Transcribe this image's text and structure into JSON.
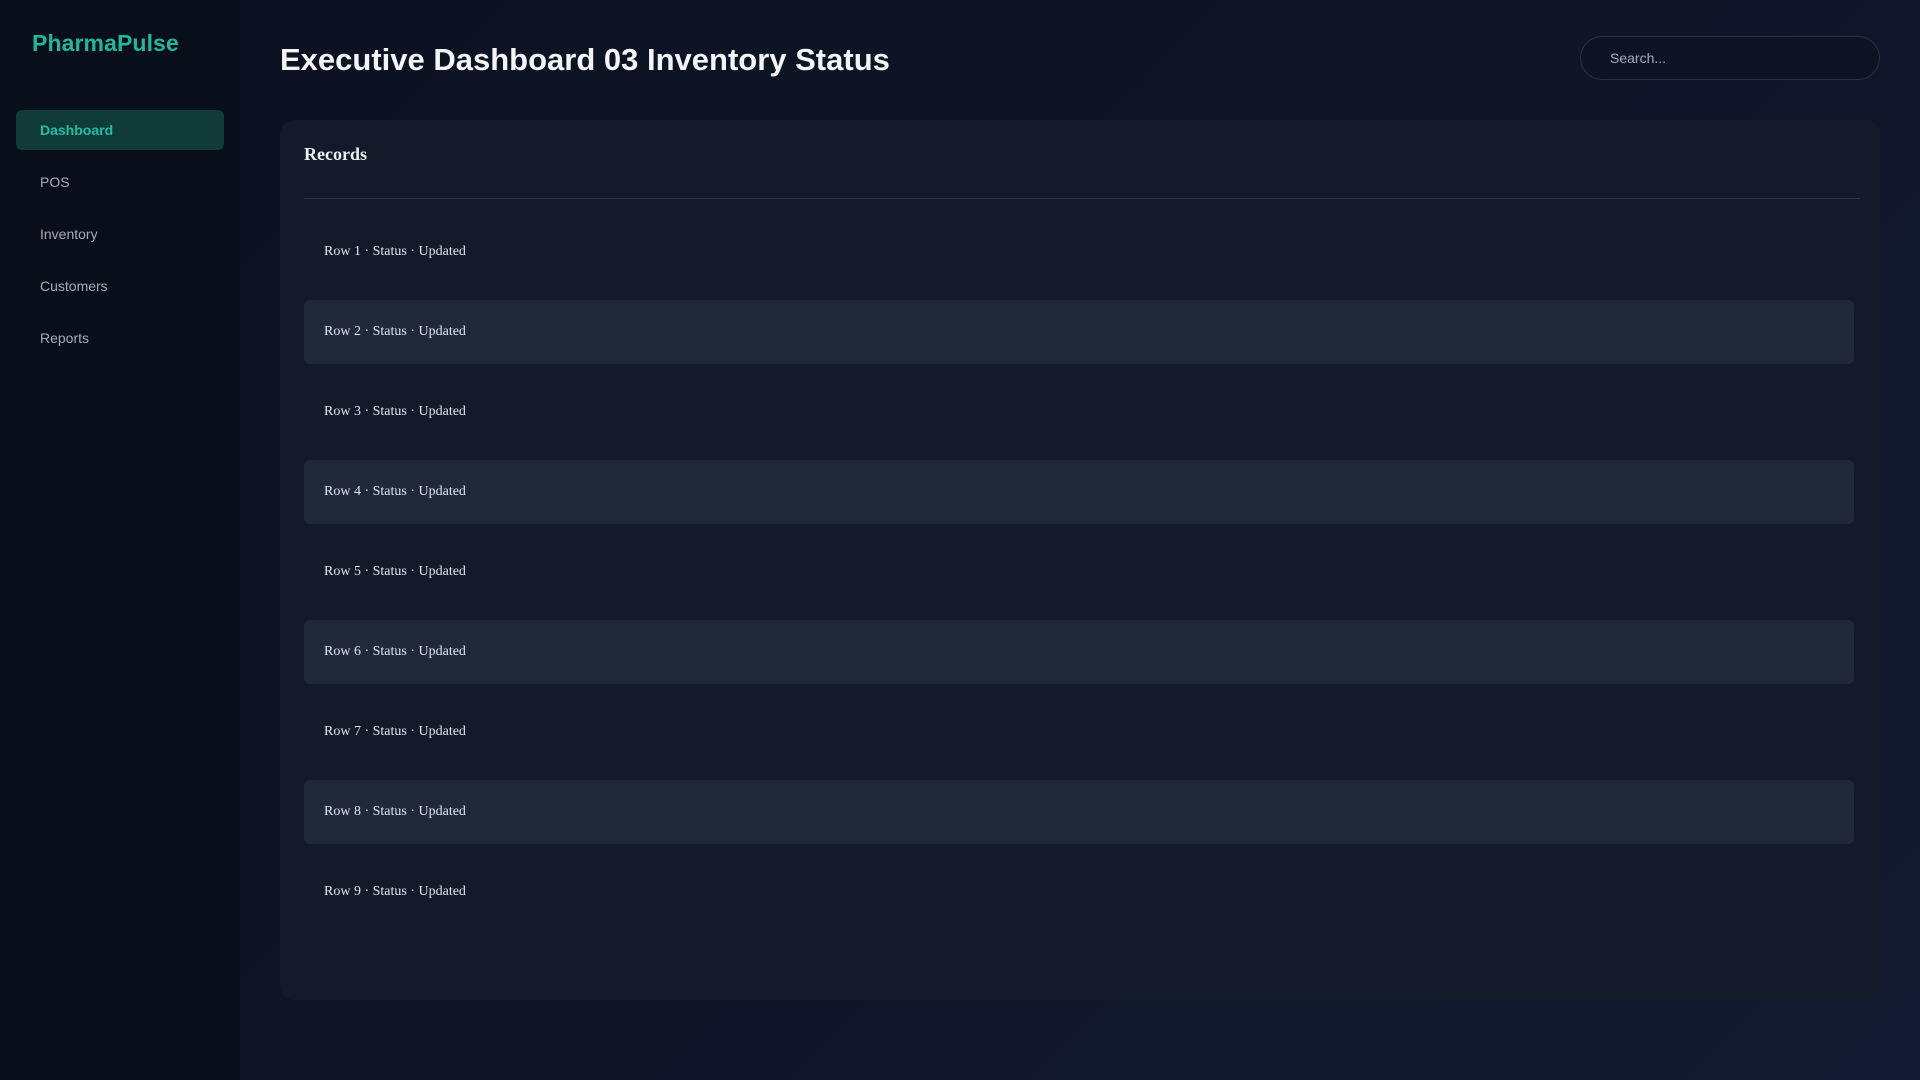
{
  "brand": {
    "name": "PharmaPulse"
  },
  "sidebar": {
    "items": [
      {
        "label": "Dashboard",
        "active": true
      },
      {
        "label": "POS"
      },
      {
        "label": "Inventory"
      },
      {
        "label": "Customers"
      },
      {
        "label": "Reports"
      }
    ]
  },
  "header": {
    "title": "Executive Dashboard 03 Inventory Status",
    "search_placeholder": "Search..."
  },
  "records": {
    "title": "Records",
    "rows": [
      "Row 1 · Status · Updated",
      "Row 2 · Status · Updated",
      "Row 3 · Status · Updated",
      "Row 4 · Status · Updated",
      "Row 5 · Status · Updated",
      "Row 6 · Status · Updated",
      "Row 7 · Status · Updated",
      "Row 8 · Status · Updated",
      "Row 9 · Status · Updated"
    ]
  },
  "colors": {
    "accent": "#1fb89c",
    "active_nav_bg": "#0f3b39",
    "sidebar_bg": "#090e1b",
    "card_bg": "#131b2b",
    "row_alt_bg": "#1f293a"
  }
}
